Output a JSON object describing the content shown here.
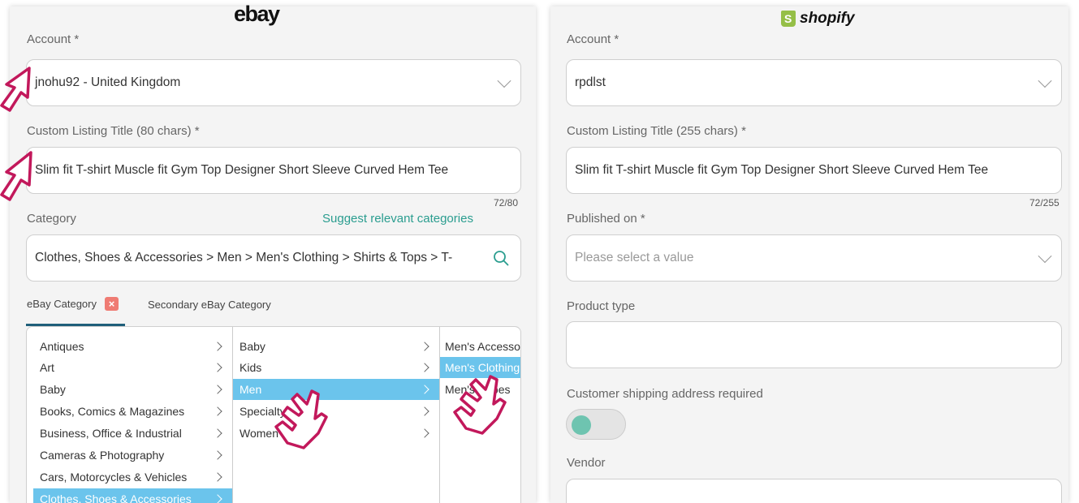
{
  "ebay": {
    "brand": "ebay",
    "account": {
      "label": "Account *",
      "value": "jnohu92 - United Kingdom"
    },
    "title": {
      "label": "Custom Listing Title (80 chars) *",
      "value": "Slim fit T-shirt Muscle fit Gym Top Designer Short Sleeve Curved Hem Tee",
      "counter": "72/80"
    },
    "category": {
      "label": "Category",
      "suggest_link": "Suggest relevant categories",
      "value": "Clothes, Shoes & Accessories > Men > Men's Clothing > Shirts & Tops > T-"
    },
    "tabs": [
      {
        "label": "eBay Category"
      },
      {
        "label": "Secondary eBay Category"
      }
    ],
    "column1": [
      "Antiques",
      "Art",
      "Baby",
      "Books, Comics & Magazines",
      "Business, Office & Industrial",
      "Cameras & Photography",
      "Cars, Motorcycles & Vehicles",
      "Clothes, Shoes & Accessories"
    ],
    "column2": [
      "Baby",
      "Kids",
      "Men",
      "Specialty",
      "Women"
    ],
    "column3": [
      "Men's Accessories",
      "Men's Clothing",
      "Men's Shoes"
    ],
    "selected": {
      "column1": "Clothes, Shoes & Accessories",
      "column2": "Men",
      "column3": "Men's Clothing"
    }
  },
  "shopify": {
    "brand": "shopify",
    "account": {
      "label": "Account *",
      "value": "rpdlst"
    },
    "title": {
      "label": "Custom Listing Title (255 chars) *",
      "value": "Slim fit T-shirt Muscle fit Gym Top Designer Short Sleeve Curved Hem Tee",
      "counter": "72/255"
    },
    "published_on": {
      "label": "Published on *",
      "placeholder": "Please select a value"
    },
    "product_type": {
      "label": "Product type",
      "value": ""
    },
    "shipping_required": {
      "label": "Customer shipping address required",
      "state": "off"
    },
    "vendor": {
      "label": "Vendor",
      "value": ""
    }
  },
  "colors": {
    "accent": "#2a9d8f",
    "selection": "#6bc4ec",
    "pointer": "#c2185b",
    "toggle_knob": "#6ec4b0"
  }
}
